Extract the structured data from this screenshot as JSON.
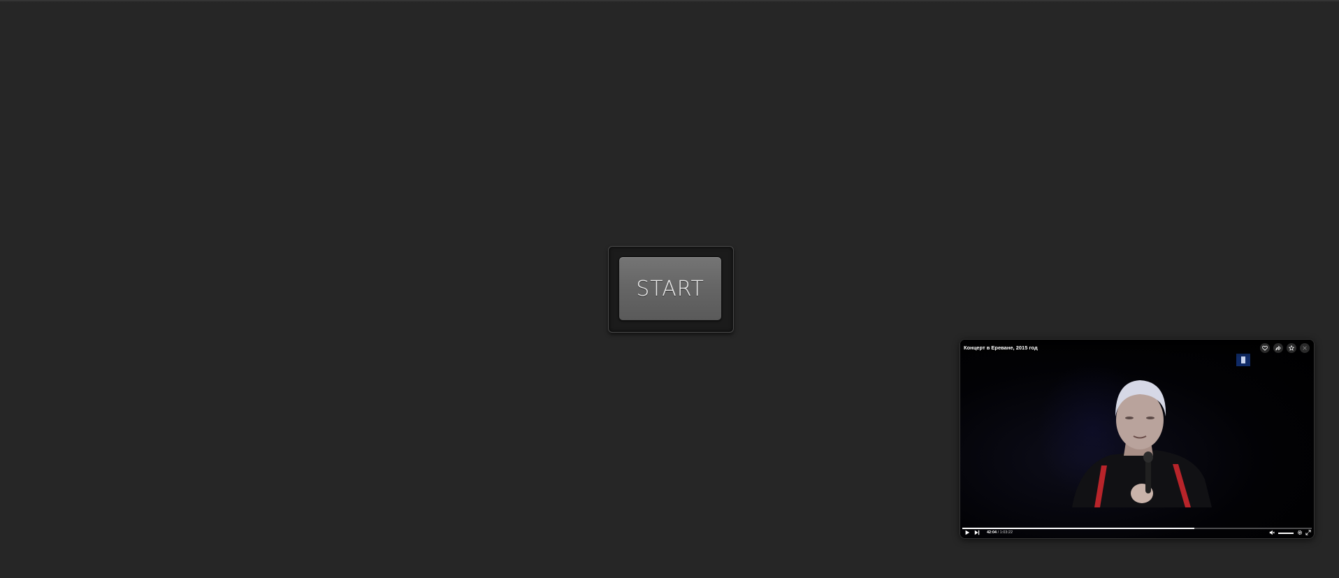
{
  "start_button": {
    "label": "START"
  },
  "player": {
    "title": "Концерт в Ереване, 2015 год",
    "current_time": "42:04",
    "separator": " / ",
    "duration": "1:03:22",
    "progress": 0.6639,
    "volume": 1.0,
    "icons": {
      "like": "heart-icon",
      "share": "share-icon",
      "favorite": "star-icon",
      "close": "close-icon",
      "play": "play-icon",
      "next": "next-icon",
      "mute": "volume-muted-icon",
      "settings": "gear-icon",
      "fullscreen": "fullscreen-icon"
    }
  }
}
